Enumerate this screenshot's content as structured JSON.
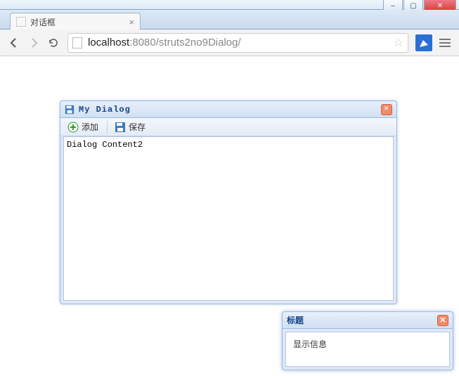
{
  "window": {
    "minimize": "–",
    "maximize": "▢",
    "close": "✕"
  },
  "tab": {
    "title": "对话框",
    "close": "×"
  },
  "address": {
    "host": "localhost",
    "port_path": ":8080/struts2no9Dialog/"
  },
  "dialog": {
    "title": "My Dialog",
    "toolbar": {
      "add_label": "添加",
      "save_label": "保存"
    },
    "content": "Dialog Content2"
  },
  "info": {
    "title": "标题",
    "message": "显示信息"
  }
}
